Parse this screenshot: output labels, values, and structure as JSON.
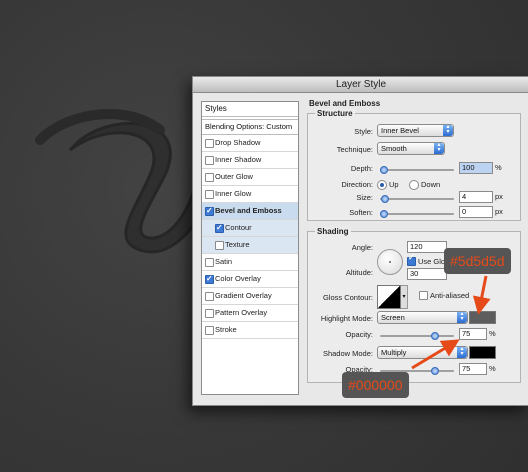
{
  "dialog": {
    "title": "Layer Style"
  },
  "styles_panel": {
    "header": "Styles",
    "blending_options": "Blending Options: Custom",
    "items": [
      {
        "label": "Drop Shadow",
        "checked": false
      },
      {
        "label": "Inner Shadow",
        "checked": false
      },
      {
        "label": "Outer Glow",
        "checked": false
      },
      {
        "label": "Inner Glow",
        "checked": false
      },
      {
        "label": "Bevel and Emboss",
        "checked": true,
        "selected": true
      },
      {
        "label": "Contour",
        "checked": true,
        "sub": true
      },
      {
        "label": "Texture",
        "checked": false,
        "sub": true
      },
      {
        "label": "Satin",
        "checked": false
      },
      {
        "label": "Color Overlay",
        "checked": true
      },
      {
        "label": "Gradient Overlay",
        "checked": false
      },
      {
        "label": "Pattern Overlay",
        "checked": false
      },
      {
        "label": "Stroke",
        "checked": false
      }
    ]
  },
  "bevel": {
    "title": "Bevel and Emboss",
    "structure": {
      "title": "Structure",
      "style_label": "Style:",
      "style_value": "Inner Bevel",
      "technique_label": "Technique:",
      "technique_value": "Smooth",
      "depth_label": "Depth:",
      "depth_value": "100",
      "depth_unit": "%",
      "depth_level": 0.0,
      "direction_label": "Direction:",
      "direction_up": "Up",
      "direction_down": "Down",
      "size_label": "Size:",
      "size_value": "4",
      "size_unit": "px",
      "size_level": 0.02,
      "soften_label": "Soften:",
      "soften_value": "0",
      "soften_unit": "px",
      "soften_level": 0.0
    },
    "shading": {
      "title": "Shading",
      "angle_label": "Angle:",
      "angle_value": "120",
      "use_global": "Use Global",
      "altitude_label": "Altitude:",
      "altitude_value": "30",
      "gloss_label": "Gloss Contour:",
      "anti_aliased": "Anti-aliased",
      "highlight_label": "Highlight Mode:",
      "highlight_value": "Screen",
      "highlight_color": "#5d5d5d",
      "opacity_label": "Opacity:",
      "highlight_opacity": "75",
      "opacity_unit": "%",
      "highlight_opacity_level": 0.75,
      "shadow_label": "Shadow Mode:",
      "shadow_value": "Multiply",
      "shadow_color": "#000000",
      "shadow_opacity": "75",
      "shadow_opacity_level": 0.75
    }
  },
  "callouts": {
    "highlight_hex": "#5d5d5d",
    "shadow_hex": "#000000",
    "color": "#e64a19"
  }
}
